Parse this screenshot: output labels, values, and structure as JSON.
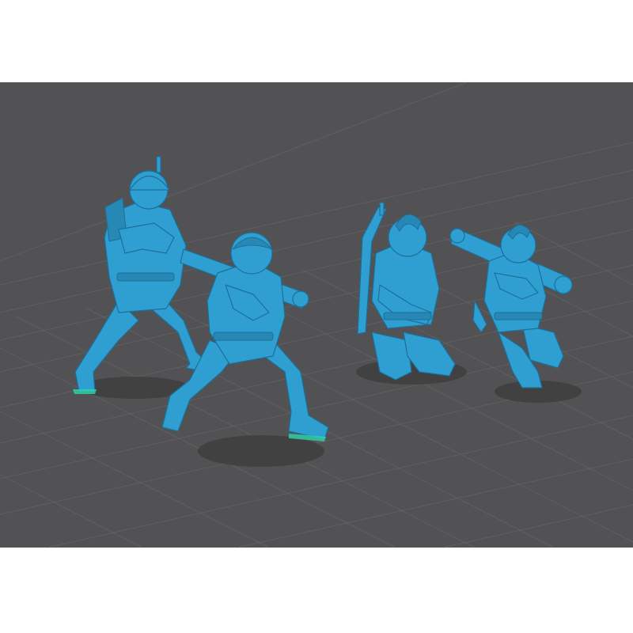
{
  "scene": {
    "background_color": "#ffffff",
    "viewport_color": "#525254",
    "grid_color": "#6a6a6d",
    "model_color": "#2f9fd2",
    "figures": [
      {
        "id": "standing-soldier-helmet"
      },
      {
        "id": "standing-bazooka-gunner"
      },
      {
        "id": "kneeling-soldier-rifle"
      },
      {
        "id": "kneeling-bazooka-gunner"
      }
    ]
  }
}
